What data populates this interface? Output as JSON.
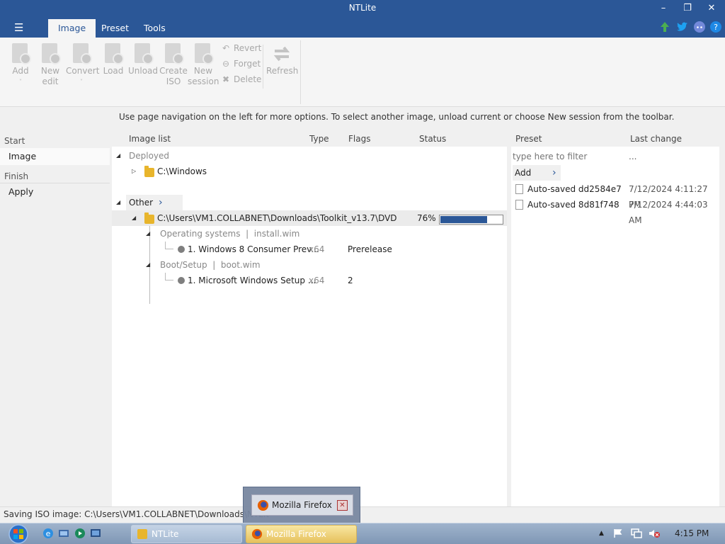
{
  "window": {
    "title": "NTLite",
    "controls": {
      "minimize": "–",
      "restore": "❐",
      "close": "✕"
    }
  },
  "ribbon": {
    "menu_icon": "hamburger-icon",
    "tabs": [
      {
        "label": "Image",
        "active": true
      },
      {
        "label": "Preset",
        "active": false
      },
      {
        "label": "Tools",
        "active": false
      }
    ],
    "top_icons": [
      "update-arrow-icon",
      "twitter-icon",
      "discord-icon",
      "help-icon"
    ]
  },
  "toolbar": {
    "add": {
      "label1": "Add",
      "label2": ""
    },
    "new_edit": {
      "label1": "New",
      "label2": "edit"
    },
    "convert": {
      "label1": "Convert",
      "label2": ""
    },
    "load": {
      "label1": "Load",
      "label2": ""
    },
    "unload": {
      "label1": "Unload",
      "label2": ""
    },
    "create_iso": {
      "label1": "Create",
      "label2": "ISO"
    },
    "new_session": {
      "label1": "New",
      "label2": "session"
    },
    "revert": "Revert",
    "forget": "Forget",
    "delete": "Delete",
    "refresh": "Refresh"
  },
  "info": {
    "text": "Use page navigation on the left for more options. To select another image, unload current or choose New session from the toolbar."
  },
  "nav": {
    "start": "Start",
    "image": "Image",
    "finish": "Finish",
    "apply": "Apply"
  },
  "image_list": {
    "columns": {
      "name": "Image list",
      "type": "Type",
      "flags": "Flags",
      "status": "Status"
    },
    "deployed_group": "Deployed",
    "deployed_item": "C:\\Windows",
    "other_group": "Other",
    "dvd_path": "C:\\Users\\VM1.COLLABNET\\Downloads\\Toolkit_v13.7\\DVD",
    "dvd_status": "76%",
    "dvd_progress": 0.76,
    "os_group": "Operating systems",
    "os_file": "install.wim",
    "os_item": {
      "name": "1. Windows 8 Consumer Prev...",
      "type": "x64",
      "flags": "Prerelease"
    },
    "boot_group": "Boot/Setup",
    "boot_file": "boot.wim",
    "boot_item": {
      "name": "1. Microsoft Windows Setup ...",
      "type": "x64",
      "flags": "2"
    }
  },
  "presets": {
    "columns": {
      "preset": "Preset",
      "last_change": "Last change"
    },
    "filter_placeholder": "type here to filter",
    "filter_change": "...",
    "add_label": "Add",
    "items": [
      {
        "name": "Auto-saved dd2584e7",
        "date": "7/12/2024 4:11:27 PM"
      },
      {
        "name": "Auto-saved 8d81f748",
        "date": "7/12/2024 4:44:03 AM"
      }
    ]
  },
  "status": {
    "text": "Saving ISO image: C:\\Users\\VM1.COLLABNET\\Downloads\\NTLit"
  },
  "popup": {
    "title": "Mozilla Firefox"
  },
  "taskbar": {
    "items": [
      {
        "label": "NTLite",
        "active": false
      },
      {
        "label": "Mozilla Firefox",
        "active": true
      }
    ],
    "clock": "4:15 PM"
  },
  "colors": {
    "accent": "#2b5797",
    "progress": "#2b5797"
  }
}
